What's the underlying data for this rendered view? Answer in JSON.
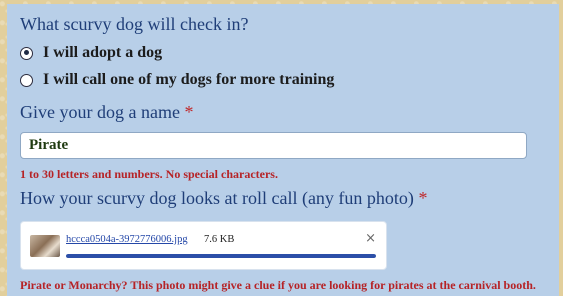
{
  "question": {
    "title": "What scurvy dog will check in?",
    "options": [
      {
        "label": "I will adopt a dog",
        "checked": true
      },
      {
        "label": "I will call one of my dogs for more training",
        "checked": false
      }
    ]
  },
  "name_field": {
    "label": "Give your dog a name",
    "required_mark": "*",
    "value": "Pirate",
    "hint": "1 to 30 letters and numbers. No special characters."
  },
  "photo_field": {
    "label": "How your scurvy dog looks at roll call (any fun photo)",
    "required_mark": "*",
    "file": {
      "name": "hccca0504a-3972776006.jpg",
      "size": "7.6 KB",
      "progress_percent": 100,
      "remove_glyph": "×"
    },
    "note": "Pirate or Monarchy? This photo might give a clue if you are looking for pirates at the carnival booth."
  },
  "colors": {
    "panel": "#b8cfe8",
    "heading": "#1f3e78",
    "required": "#c0282a",
    "progress": "#2c4fa8"
  }
}
